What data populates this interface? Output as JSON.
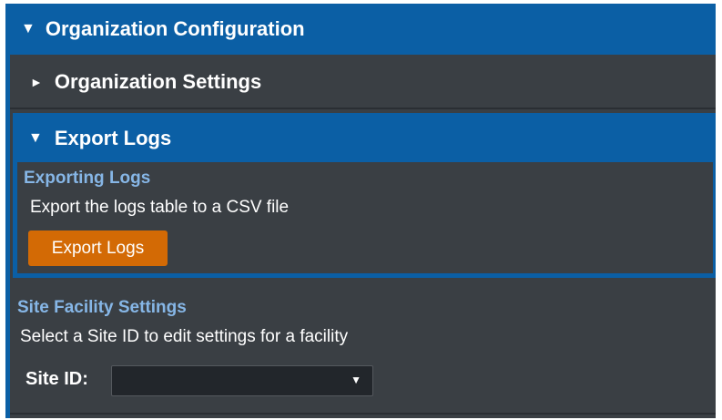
{
  "header": {
    "toggle_icon": "▼",
    "title": "Organization Configuration"
  },
  "org_settings": {
    "toggle_icon": "►",
    "title": "Organization Settings"
  },
  "export_logs": {
    "toggle_icon": "▼",
    "title": "Export Logs",
    "sub_title": "Exporting Logs",
    "description": "Export the logs table to a CSV file",
    "button_label": "Export Logs"
  },
  "site_facility": {
    "title": "Site Facility Settings",
    "description": "Select a Site ID to edit settings for a facility",
    "site_id_label": "Site ID:",
    "site_id_value": "",
    "caret_icon": "▼"
  },
  "colors": {
    "header_blue": "#0b5fa5",
    "panel_gray": "#3a3f44",
    "subtitle_blue": "#86b6e6",
    "button_orange": "#d36a05"
  }
}
